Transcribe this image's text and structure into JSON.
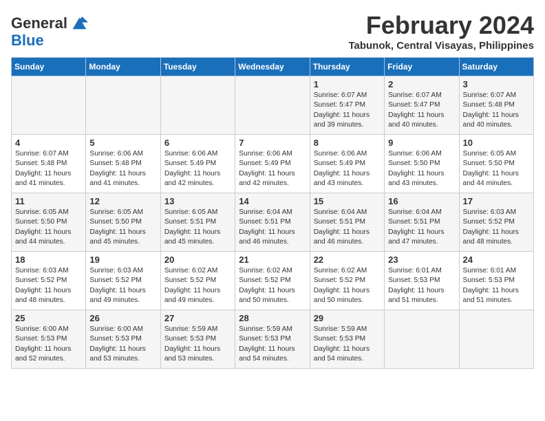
{
  "logo": {
    "line1": "General",
    "line2": "Blue"
  },
  "title": "February 2024",
  "subtitle": "Tabunok, Central Visayas, Philippines",
  "header": {
    "days": [
      "Sunday",
      "Monday",
      "Tuesday",
      "Wednesday",
      "Thursday",
      "Friday",
      "Saturday"
    ]
  },
  "weeks": [
    [
      {
        "day": "",
        "info": ""
      },
      {
        "day": "",
        "info": ""
      },
      {
        "day": "",
        "info": ""
      },
      {
        "day": "",
        "info": ""
      },
      {
        "day": "1",
        "info": "Sunrise: 6:07 AM\nSunset: 5:47 PM\nDaylight: 11 hours and 39 minutes."
      },
      {
        "day": "2",
        "info": "Sunrise: 6:07 AM\nSunset: 5:47 PM\nDaylight: 11 hours and 40 minutes."
      },
      {
        "day": "3",
        "info": "Sunrise: 6:07 AM\nSunset: 5:48 PM\nDaylight: 11 hours and 40 minutes."
      }
    ],
    [
      {
        "day": "4",
        "info": "Sunrise: 6:07 AM\nSunset: 5:48 PM\nDaylight: 11 hours and 41 minutes."
      },
      {
        "day": "5",
        "info": "Sunrise: 6:06 AM\nSunset: 5:48 PM\nDaylight: 11 hours and 41 minutes."
      },
      {
        "day": "6",
        "info": "Sunrise: 6:06 AM\nSunset: 5:49 PM\nDaylight: 11 hours and 42 minutes."
      },
      {
        "day": "7",
        "info": "Sunrise: 6:06 AM\nSunset: 5:49 PM\nDaylight: 11 hours and 42 minutes."
      },
      {
        "day": "8",
        "info": "Sunrise: 6:06 AM\nSunset: 5:49 PM\nDaylight: 11 hours and 43 minutes."
      },
      {
        "day": "9",
        "info": "Sunrise: 6:06 AM\nSunset: 5:50 PM\nDaylight: 11 hours and 43 minutes."
      },
      {
        "day": "10",
        "info": "Sunrise: 6:05 AM\nSunset: 5:50 PM\nDaylight: 11 hours and 44 minutes."
      }
    ],
    [
      {
        "day": "11",
        "info": "Sunrise: 6:05 AM\nSunset: 5:50 PM\nDaylight: 11 hours and 44 minutes."
      },
      {
        "day": "12",
        "info": "Sunrise: 6:05 AM\nSunset: 5:50 PM\nDaylight: 11 hours and 45 minutes."
      },
      {
        "day": "13",
        "info": "Sunrise: 6:05 AM\nSunset: 5:51 PM\nDaylight: 11 hours and 45 minutes."
      },
      {
        "day": "14",
        "info": "Sunrise: 6:04 AM\nSunset: 5:51 PM\nDaylight: 11 hours and 46 minutes."
      },
      {
        "day": "15",
        "info": "Sunrise: 6:04 AM\nSunset: 5:51 PM\nDaylight: 11 hours and 46 minutes."
      },
      {
        "day": "16",
        "info": "Sunrise: 6:04 AM\nSunset: 5:51 PM\nDaylight: 11 hours and 47 minutes."
      },
      {
        "day": "17",
        "info": "Sunrise: 6:03 AM\nSunset: 5:52 PM\nDaylight: 11 hours and 48 minutes."
      }
    ],
    [
      {
        "day": "18",
        "info": "Sunrise: 6:03 AM\nSunset: 5:52 PM\nDaylight: 11 hours and 48 minutes."
      },
      {
        "day": "19",
        "info": "Sunrise: 6:03 AM\nSunset: 5:52 PM\nDaylight: 11 hours and 49 minutes."
      },
      {
        "day": "20",
        "info": "Sunrise: 6:02 AM\nSunset: 5:52 PM\nDaylight: 11 hours and 49 minutes."
      },
      {
        "day": "21",
        "info": "Sunrise: 6:02 AM\nSunset: 5:52 PM\nDaylight: 11 hours and 50 minutes."
      },
      {
        "day": "22",
        "info": "Sunrise: 6:02 AM\nSunset: 5:52 PM\nDaylight: 11 hours and 50 minutes."
      },
      {
        "day": "23",
        "info": "Sunrise: 6:01 AM\nSunset: 5:53 PM\nDaylight: 11 hours and 51 minutes."
      },
      {
        "day": "24",
        "info": "Sunrise: 6:01 AM\nSunset: 5:53 PM\nDaylight: 11 hours and 51 minutes."
      }
    ],
    [
      {
        "day": "25",
        "info": "Sunrise: 6:00 AM\nSunset: 5:53 PM\nDaylight: 11 hours and 52 minutes."
      },
      {
        "day": "26",
        "info": "Sunrise: 6:00 AM\nSunset: 5:53 PM\nDaylight: 11 hours and 53 minutes."
      },
      {
        "day": "27",
        "info": "Sunrise: 5:59 AM\nSunset: 5:53 PM\nDaylight: 11 hours and 53 minutes."
      },
      {
        "day": "28",
        "info": "Sunrise: 5:59 AM\nSunset: 5:53 PM\nDaylight: 11 hours and 54 minutes."
      },
      {
        "day": "29",
        "info": "Sunrise: 5:59 AM\nSunset: 5:53 PM\nDaylight: 11 hours and 54 minutes."
      },
      {
        "day": "",
        "info": ""
      },
      {
        "day": "",
        "info": ""
      }
    ]
  ]
}
